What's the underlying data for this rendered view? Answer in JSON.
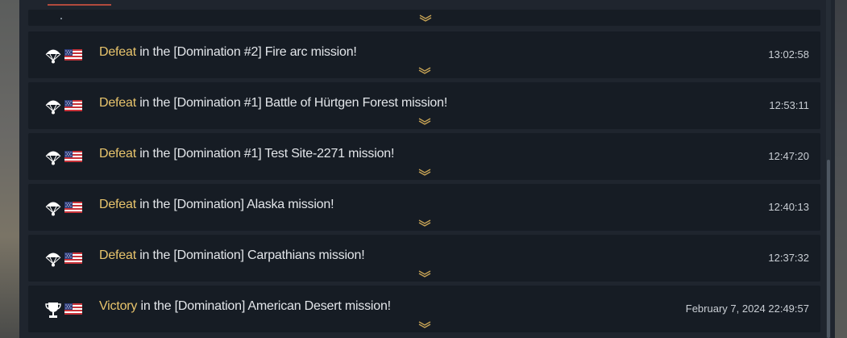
{
  "messages": [
    {
      "result": "Defeat",
      "type": "defeat",
      "icon": "parachute-icon",
      "text": " in the [Domination #2] Fire arc mission!",
      "time": "13:02:58"
    },
    {
      "result": "Defeat",
      "type": "defeat",
      "icon": "parachute-icon",
      "text": " in the [Domination #1] Battle of Hürtgen Forest mission!",
      "time": "12:53:11"
    },
    {
      "result": "Defeat",
      "type": "defeat",
      "icon": "parachute-icon",
      "text": " in the [Domination #1] Test Site-2271 mission!",
      "time": "12:47:20"
    },
    {
      "result": "Defeat",
      "type": "defeat",
      "icon": "parachute-icon",
      "text": " in the [Domination] Alaska mission!",
      "time": "12:40:13"
    },
    {
      "result": "Defeat",
      "type": "defeat",
      "icon": "parachute-icon",
      "text": " in the [Domination] Carpathians mission!",
      "time": "12:37:32"
    },
    {
      "result": "Victory",
      "type": "victory",
      "icon": "trophy-icon",
      "text": " in the [Domination] American Desert mission!",
      "time": "February 7, 2024 22:49:57"
    }
  ],
  "colors": {
    "accent": "#e8c46c",
    "tab_accent": "#b24a3d",
    "row_bg": "#161c24",
    "panel_bg": "#1f252e"
  }
}
